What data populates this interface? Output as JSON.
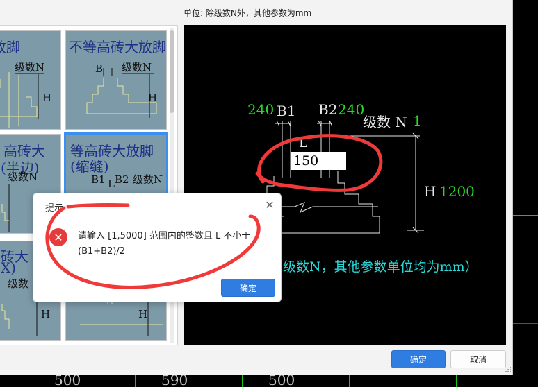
{
  "dialog": {
    "unit_text": "单位:   除级数N外，其他参数为mm",
    "ok_label": "确定",
    "cancel_label": "取消"
  },
  "gallery": {
    "tiles": [
      {
        "title": "砖大放脚",
        "label_n": "级数N",
        "label_h": "H"
      },
      {
        "title": "不等高砖大放脚",
        "label_b": "B",
        "label_n": "级数N",
        "label_h": "H"
      },
      {
        "title": "高砖大",
        "title2": "(半边)",
        "label_n": "级数N"
      },
      {
        "title": "等高砖大放脚",
        "title2": "(缩缝)",
        "label_b1": "B1",
        "label_l": "L",
        "label_b2": "B2",
        "label_n": "级数N"
      },
      {
        "title": "砖大",
        "title2": "X)",
        "label_n": "级数",
        "label_h": "H"
      },
      {
        "label_h": "H"
      }
    ]
  },
  "preview": {
    "val_240_left": "240",
    "label_b1": "B1",
    "label_b2": "B2",
    "val_240_right": "240",
    "label_n": "级数 N",
    "val_n": "1",
    "label_l": "L",
    "l_input_value": "150",
    "label_h": "H",
    "val_h": "1200",
    "note": "除级数N，其他参数单位均为mm）"
  },
  "msgbox": {
    "title": "提示",
    "close_icon": "✕",
    "line1": "请输入 [1,5000] 范围内的整数且 L 不小于",
    "line2": "(B1+B2)/2",
    "ok_label": "确定"
  },
  "cad_bottom": {
    "numbers": [
      "500",
      "590",
      "500"
    ]
  },
  "colors": {
    "accent": "#2f7de1",
    "cad_green": "#29d829",
    "cad_cyan": "#2bd8d8",
    "tile_bg": "#7d9aa8",
    "error_red": "#e63b3b",
    "annotation_red": "#f03a3a"
  }
}
